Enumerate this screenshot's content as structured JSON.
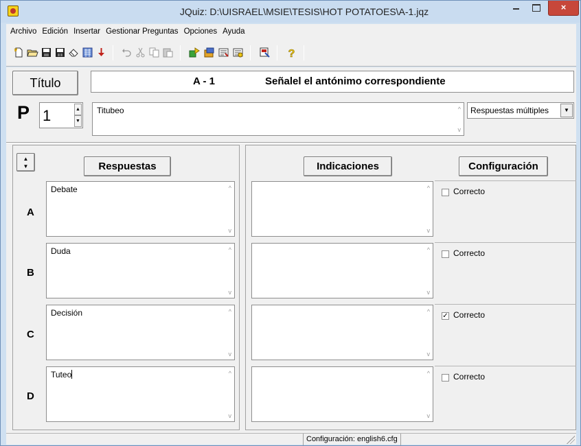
{
  "window": {
    "title": "JQuiz: D:\\UISRAEL\\MSIE\\TESIS\\HOT POTATOES\\A-1.jqz",
    "close_glyph": "×"
  },
  "menu": [
    "Archivo",
    "Edición",
    "Insertar",
    "Gestionar Preguntas",
    "Opciones",
    "Ayuda"
  ],
  "toolbar_icons": [
    "new-icon",
    "open-icon",
    "save-icon",
    "save-as-icon",
    "erase-icon",
    "web-page-icon",
    "download-icon",
    "undo-icon",
    "cut-icon",
    "copy-icon",
    "paste-icon",
    "add-icon",
    "import-icon",
    "export-icon",
    "config-icon",
    "paint-icon",
    "help-icon"
  ],
  "title_section": {
    "button_label": "Título",
    "code": "A - 1",
    "text": "Señalel el antónimo correspondiente"
  },
  "question": {
    "label": "P",
    "number": "1",
    "text": "Titubeo",
    "type": "Respuestas múltiples"
  },
  "headers": {
    "answers": "Respuestas",
    "feedback": "Indicaciones",
    "settings": "Configuración"
  },
  "answers": [
    {
      "letter": "A",
      "text": "Debate",
      "feedback": "",
      "correct_label": "Correcto",
      "correct": false
    },
    {
      "letter": "B",
      "text": "Duda",
      "feedback": "",
      "correct_label": "Correcto",
      "correct": false
    },
    {
      "letter": "C",
      "text": "Decisión",
      "feedback": "",
      "correct_label": "Correcto",
      "correct": true
    },
    {
      "letter": "D",
      "text": "Tuteo",
      "feedback": "",
      "correct_label": "Correcto",
      "correct": false
    }
  ],
  "status": {
    "config_file": "Configuración: english6.cfg"
  }
}
